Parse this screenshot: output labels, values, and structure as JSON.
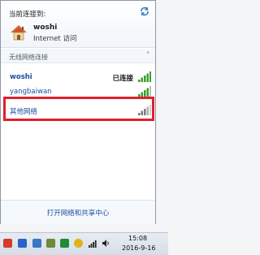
{
  "header": {
    "title": "当前连接到:",
    "network_name": "woshi",
    "network_status": "Internet 访问",
    "icons": [
      "refresh-icon",
      "house-network-icon"
    ]
  },
  "section": {
    "label": "无线网络连接",
    "collapse_glyph": "˄"
  },
  "networks": [
    {
      "name": "woshi",
      "status": "已连接",
      "signal_bars": 4
    },
    {
      "name": "yangbaiwan",
      "status": "",
      "signal_bars": 4
    },
    {
      "name": "其他网络",
      "status": "",
      "signal_bars": 3,
      "highlighted": true
    }
  ],
  "footer": {
    "link": "打开网络和共享中心"
  },
  "taskbar": {
    "time": "15:08",
    "date": "2016-9-16",
    "tray_icons": [
      "security-flag-icon",
      "bluetooth-icon",
      "mixed-icon",
      "user-icon",
      "shield-icon",
      "chrome-icon",
      "network-signal-icon",
      "volume-icon"
    ]
  },
  "colors": {
    "link": "#1a4fa0",
    "highlight": "#e0202a",
    "signal_green": "#3a9e2e"
  }
}
